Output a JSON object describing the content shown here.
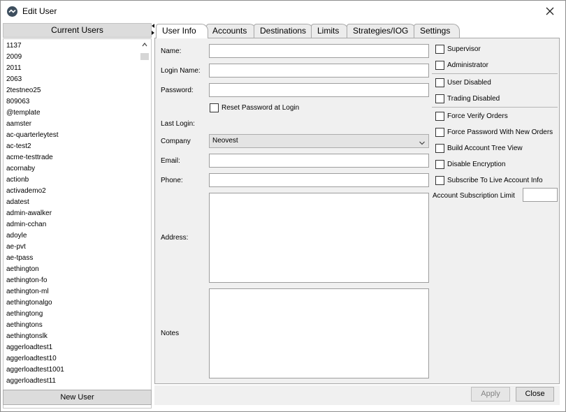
{
  "window": {
    "title": "Edit User"
  },
  "users": {
    "header": "Current Users",
    "items": [
      "1137",
      "2009",
      "2011",
      "2063",
      "2testneo25",
      "809063",
      "@template",
      "aamster",
      "ac-quarterleytest",
      "ac-test2",
      "acme-testtrade",
      "acornaby",
      "actionb",
      "activademo2",
      "adatest",
      "admin-awalker",
      "admin-cchan",
      "adoyle",
      "ae-pvt",
      "ae-tpass",
      "aethington",
      "aethington-fo",
      "aethington-ml",
      "aethingtonalgo",
      "aethingtong",
      "aethingtons",
      "aethingtonslk",
      "aggerloadtest1",
      "aggerloadtest10",
      "aggerloadtest1001",
      "aggerloadtest11"
    ],
    "new_user_label": "New User"
  },
  "tabs": [
    "User Info",
    "Accounts",
    "Destinations",
    "Limits",
    "Strategies/IOG",
    "Settings"
  ],
  "form": {
    "name_label": "Name:",
    "name_value": "",
    "login_label": "Login Name:",
    "login_value": "",
    "password_label": "Password:",
    "password_value": "",
    "reset_label": "Reset Password at Login",
    "last_login_label": "Last Login:",
    "company_label": "Company",
    "company_value": "Neovest",
    "email_label": "Email:",
    "email_value": "",
    "phone_label": "Phone:",
    "phone_value": "",
    "address_label": "Address:",
    "notes_label": "Notes"
  },
  "options": {
    "supervisor": "Supervisor",
    "administrator": "Administrator",
    "user_disabled": "User Disabled",
    "trading_disabled": "Trading Disabled",
    "force_verify": "Force Verify Orders",
    "force_password": "Force Password With New Orders",
    "build_tree": "Build Account Tree View",
    "disable_encryption": "Disable Encryption",
    "subscribe_live": "Subscribe To Live Account Info",
    "sub_limit_label": "Account Subscription Limit",
    "sub_limit_value": ""
  },
  "buttons": {
    "apply": "Apply",
    "close": "Close"
  }
}
